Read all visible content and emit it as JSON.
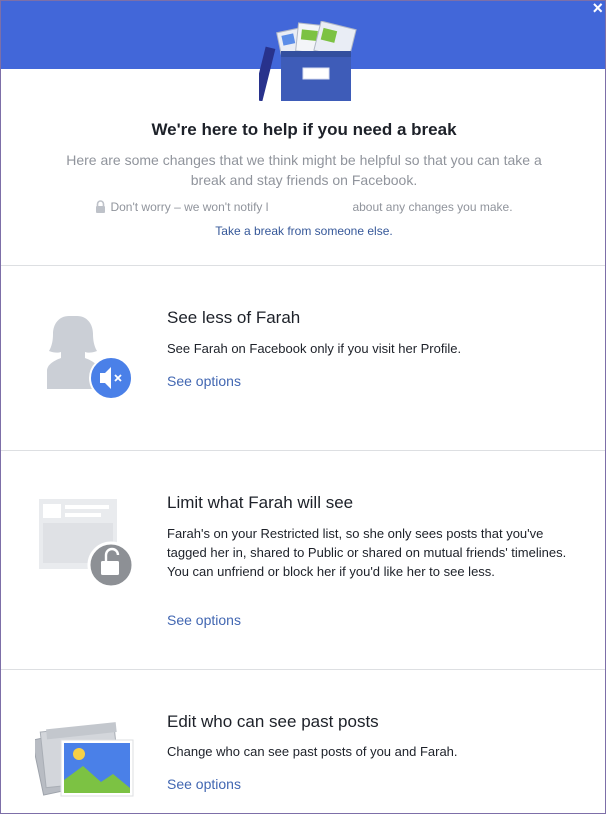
{
  "header": {
    "close_label": "×",
    "banner_color": "#4267d9"
  },
  "intro": {
    "title": "We're here to help if you need a break",
    "subtitle": "Here are some changes that we think might be helpful so that you can take a break and stay friends on Facebook.",
    "notify_prefix": "Don't worry – we won't notify",
    "notify_cursor": "l",
    "notify_suffix": "about any changes you make.",
    "take_break_link": "Take a break from someone else."
  },
  "sections": [
    {
      "title": "See less of Farah",
      "description": "See Farah on Facebook only if you visit her Profile.",
      "link": "See options",
      "icon": "muted-person-icon"
    },
    {
      "title": "Limit what Farah will see",
      "description": "Farah's on your Restricted list, so she only sees posts that you've tagged her in, shared to Public or shared on mutual friends' timelines. You can unfriend or block her if you'd like her to see less.",
      "link": "See options",
      "icon": "restricted-profile-icon"
    },
    {
      "title": "Edit who can see past posts",
      "description": "Change who can see past posts of you and Farah.",
      "link": "See options",
      "icon": "past-posts-photo-icon"
    }
  ],
  "colors": {
    "link": "#4267b2",
    "muted_text": "#90949c",
    "accent_blue": "#4a80e8"
  }
}
